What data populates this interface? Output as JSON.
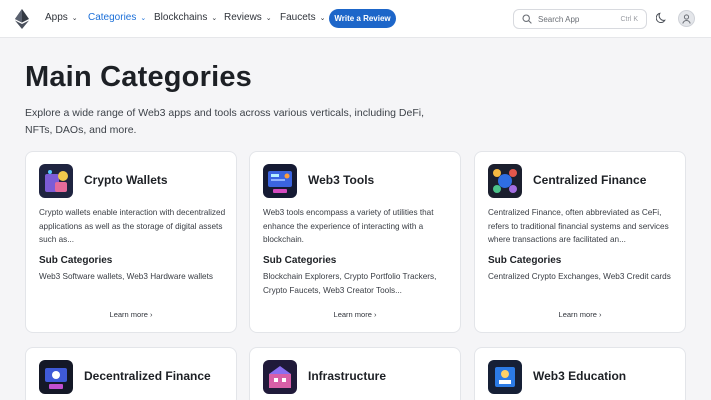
{
  "nav": {
    "items": [
      {
        "label": "Apps",
        "active": false
      },
      {
        "label": "Categories",
        "active": true
      },
      {
        "label": "Blockchains",
        "active": false
      },
      {
        "label": "Reviews",
        "active": false
      },
      {
        "label": "Faucets",
        "active": false
      }
    ],
    "cta_label": "Write a Review",
    "search": {
      "placeholder": "Search App",
      "shortcut": "Ctrl K"
    },
    "chevron": "⌄",
    "accent": "#1d66c9"
  },
  "hero": {
    "title": "Main Categories",
    "subtitle": "Explore a wide range of Web3 apps and tools across various verticals, including DeFi, NFTs, DAOs, and more."
  },
  "cards": [
    {
      "title": "Crypto Wallets",
      "icon": "wallet-icon",
      "description": "Crypto wallets enable interaction with decentralized applications as well as the storage of digital assets such as...",
      "sub_heading": "Sub Categories",
      "sub_list": "Web3 Software wallets, Web3 Hardware wallets",
      "more": "Learn more ›"
    },
    {
      "title": "Web3 Tools",
      "icon": "tools-icon",
      "description": "Web3 tools encompass a variety of utilities that enhance the experience of interacting with a blockchain.",
      "sub_heading": "Sub Categories",
      "sub_list": "Blockchain Explorers, Crypto Portfolio Trackers, Crypto Faucets, Web3 Creator Tools...",
      "more": "Learn more ›"
    },
    {
      "title": "Centralized Finance",
      "icon": "cefi-icon",
      "description": "Centralized Finance, often abbreviated as CeFi, refers to traditional financial systems and services where transactions are facilitated an...",
      "sub_heading": "Sub Categories",
      "sub_list": "Centralized Crypto Exchanges, Web3 Credit cards",
      "more": "Learn more ›"
    },
    {
      "title": "Decentralized Finance",
      "icon": "defi-icon"
    },
    {
      "title": "Infrastructure",
      "icon": "infrastructure-icon"
    },
    {
      "title": "Web3 Education",
      "icon": "education-icon"
    }
  ]
}
